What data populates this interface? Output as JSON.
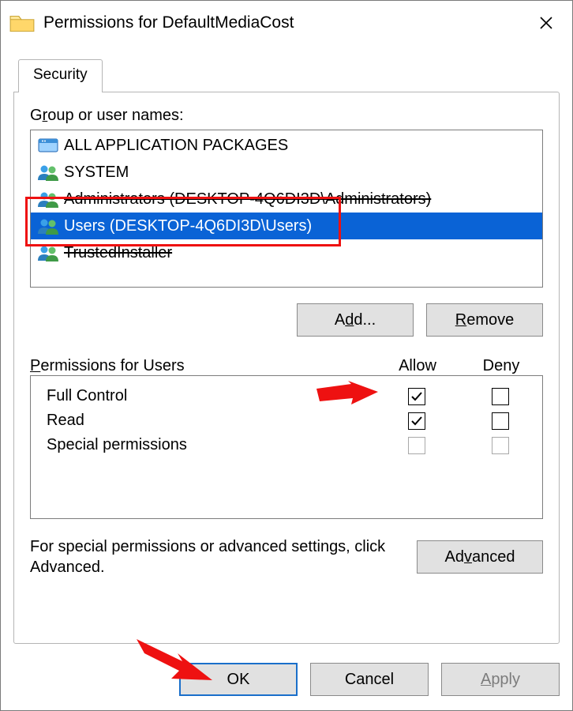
{
  "window": {
    "title": "Permissions for DefaultMediaCost"
  },
  "tab": {
    "security": "Security"
  },
  "groupLabelPre": "G",
  "groupLabelUnd": "r",
  "groupLabelPost": "oup or user names:",
  "principals": [
    {
      "icon": "package",
      "label": "ALL APPLICATION PACKAGES",
      "selected": false,
      "strike": false
    },
    {
      "icon": "group",
      "label": "SYSTEM",
      "selected": false,
      "strike": false
    },
    {
      "icon": "group",
      "label": "Administrators (DESKTOP-4Q6DI3D\\Administrators)",
      "selected": false,
      "strike": true
    },
    {
      "icon": "group",
      "label": "Users (DESKTOP-4Q6DI3D\\Users)",
      "selected": true,
      "strike": false
    },
    {
      "icon": "group",
      "label": "TrustedInstaller",
      "selected": false,
      "strike": true
    }
  ],
  "btn": {
    "add": {
      "pre": "A",
      "und": "d",
      "post": "d..."
    },
    "remove": {
      "und": "R",
      "post": "emove"
    },
    "advanced": {
      "pre": "Ad",
      "und": "v",
      "post": "anced"
    },
    "ok": "OK",
    "cancel": "Cancel",
    "apply": {
      "und": "A",
      "post": "pply"
    }
  },
  "permHeader": {
    "labelUnd": "P",
    "labelPost": "ermissions for Users",
    "allow": "Allow",
    "deny": "Deny"
  },
  "perms": [
    {
      "name": "Full Control",
      "allow": true,
      "deny": false,
      "disabled": false
    },
    {
      "name": "Read",
      "allow": true,
      "deny": false,
      "disabled": false
    },
    {
      "name": "Special permissions",
      "allow": false,
      "deny": false,
      "disabled": true
    }
  ],
  "hint": "For special permissions or advanced settings, click Advanced."
}
